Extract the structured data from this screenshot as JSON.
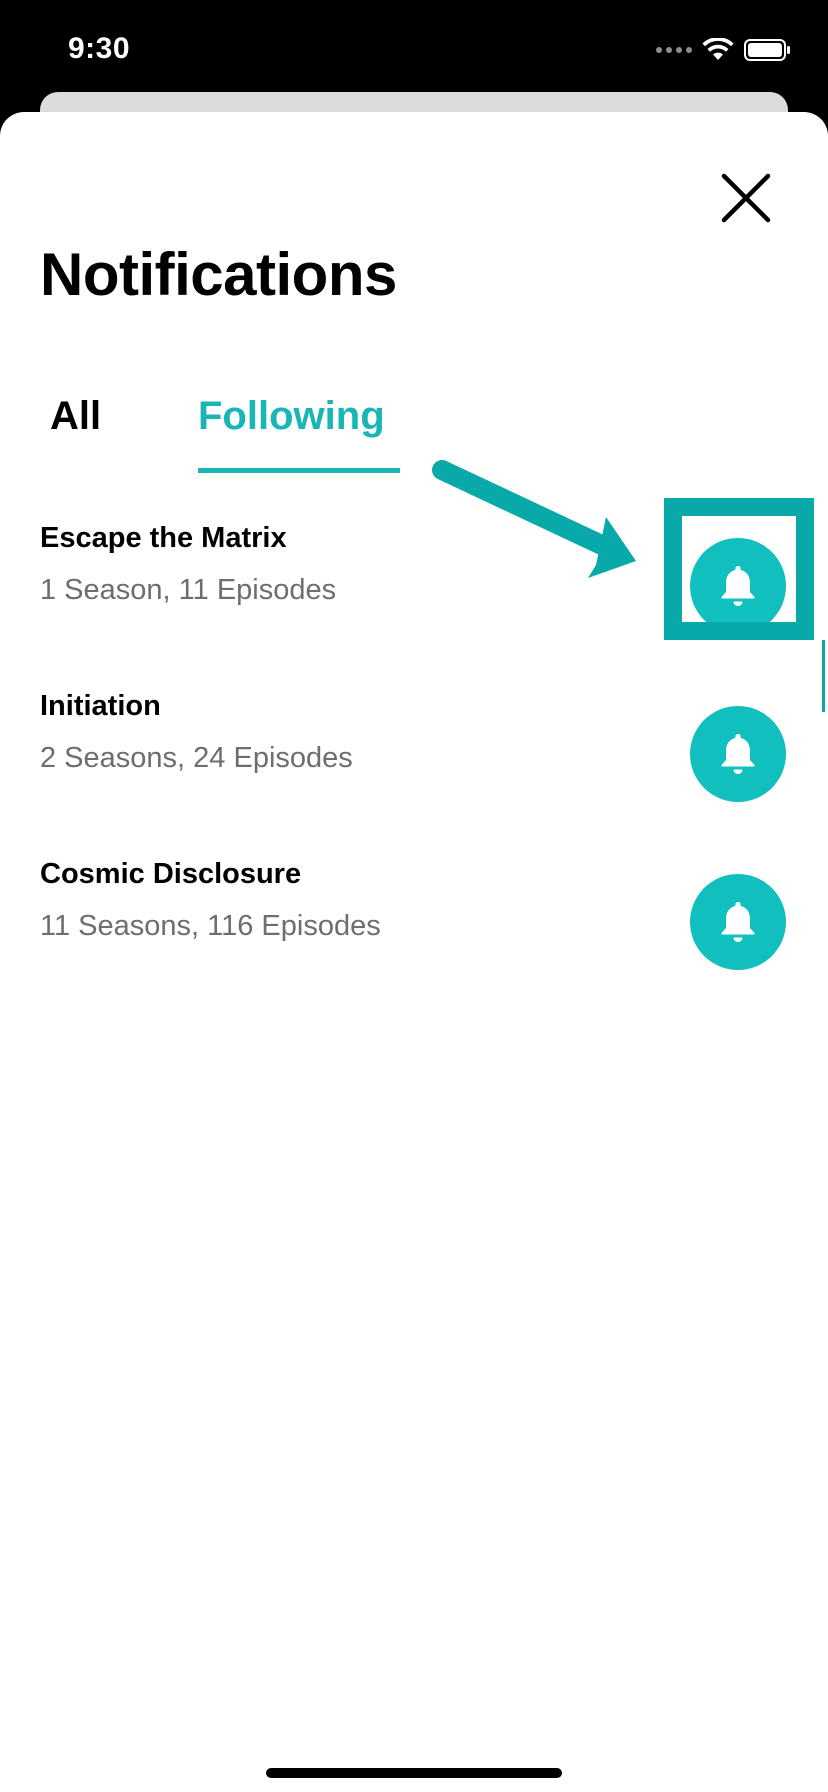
{
  "status_bar": {
    "time": "9:30"
  },
  "header": {
    "title": "Notifications",
    "close_icon": "close-icon"
  },
  "tabs": [
    {
      "label": "All",
      "active": false
    },
    {
      "label": "Following",
      "active": true
    }
  ],
  "items": [
    {
      "title": "Escape the Matrix",
      "subtitle": "1 Season, 11 Episodes",
      "icon": "bell-icon"
    },
    {
      "title": "Initiation",
      "subtitle": "2 Seasons, 24 Episodes",
      "icon": "bell-icon"
    },
    {
      "title": "Cosmic Disclosure",
      "subtitle": "11 Seasons, 116 Episodes",
      "icon": "bell-icon"
    }
  ],
  "colors": {
    "accent": "#12bfbf",
    "annotation": "#0aa9a9",
    "subtitle_text": "#6e6e6e"
  }
}
